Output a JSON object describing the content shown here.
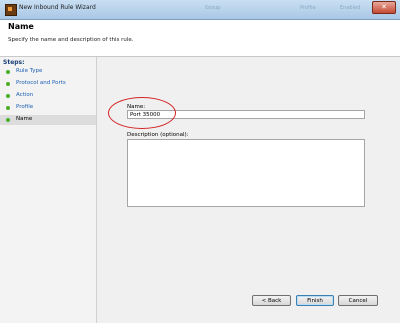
{
  "window": {
    "title": "New Inbound Rule Wizard",
    "background_ghost": [
      "Group",
      "Profile",
      "Enabled"
    ],
    "close_symbol": "✕"
  },
  "header": {
    "title": "Name",
    "subtitle": "Specify the name and description of this rule."
  },
  "steps": {
    "title": "Steps:",
    "items": [
      {
        "label": "Rule Type"
      },
      {
        "label": "Protocol and Ports"
      },
      {
        "label": "Action"
      },
      {
        "label": "Profile"
      },
      {
        "label": "Name",
        "active": true
      }
    ],
    "dot_color": "#4caf27"
  },
  "form": {
    "name_label": "Name:",
    "name_value": "Port 35000",
    "description_label": "Description (optional):",
    "description_value": ""
  },
  "buttons": {
    "back": "< Back",
    "finish": "Finish",
    "cancel": "Cancel"
  },
  "annotation": {
    "highlight_color": "#d32424"
  }
}
